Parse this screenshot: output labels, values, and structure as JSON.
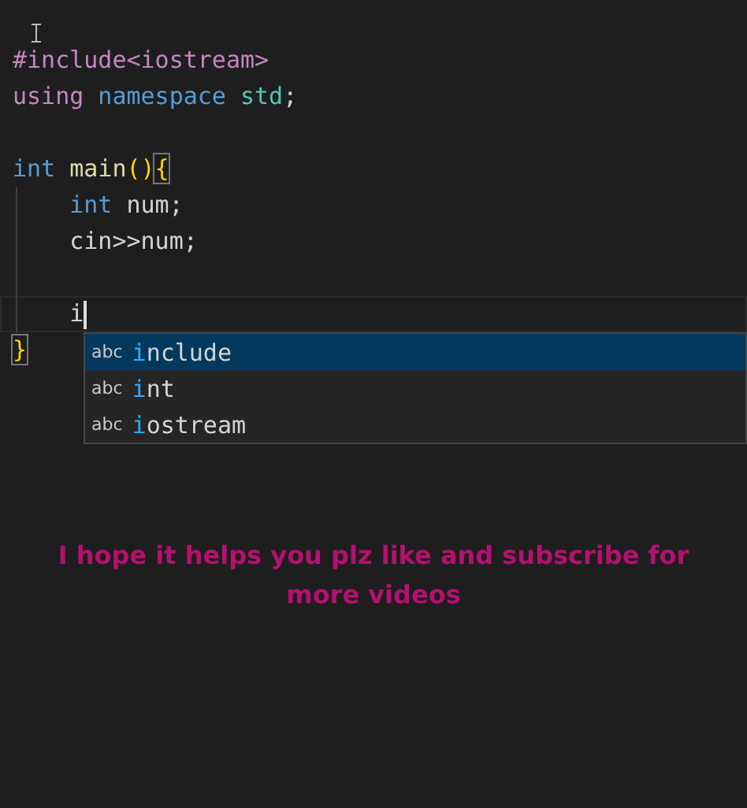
{
  "editor": {
    "lines": [
      {
        "tokens": [
          {
            "text": "#include<iostream>",
            "kind": "directive"
          }
        ]
      },
      {
        "tokens": [
          {
            "text": "using",
            "kind": "directive"
          },
          {
            "text": "namespace",
            "kind": "keyword"
          },
          {
            "text": "std",
            "kind": "type"
          },
          {
            "text": ";",
            "kind": "plain",
            "glued": true
          }
        ]
      },
      {
        "gap_before": true,
        "tokens": [
          {
            "text": "int",
            "kind": "keyword"
          },
          {
            "text": "main",
            "kind": "function"
          },
          {
            "text": "()",
            "kind": "paren",
            "glued": true
          },
          {
            "text": "{",
            "kind": "paren",
            "glued": true,
            "matched": true
          }
        ]
      },
      {
        "indented": true,
        "tokens": [
          {
            "text": "int",
            "kind": "keyword"
          },
          {
            "text": "num;",
            "kind": "plain"
          }
        ]
      },
      {
        "indented": true,
        "tokens": [
          {
            "text": "cin>>num;",
            "kind": "plain"
          }
        ]
      },
      {
        "gap_before": true,
        "indented": true,
        "tokens": [
          {
            "text": "i",
            "kind": "plain"
          }
        ],
        "current": true
      },
      {
        "tokens": [
          {
            "text": "}",
            "kind": "paren",
            "matched": true
          }
        ]
      }
    ],
    "suggestions": [
      {
        "kind_label": "abc",
        "match": "i",
        "rest": "nclude",
        "selected": true
      },
      {
        "kind_label": "abc",
        "match": "i",
        "rest": "nt",
        "selected": false
      },
      {
        "kind_label": "abc",
        "match": "i",
        "rest": "ostream",
        "selected": false
      }
    ]
  },
  "caption": "I hope it helps you plz like and subscribe for more videos"
}
